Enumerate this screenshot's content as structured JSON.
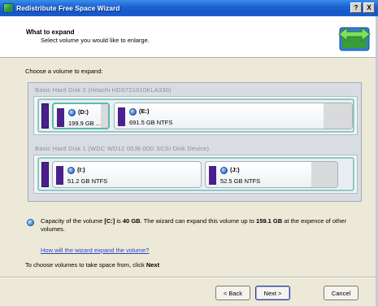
{
  "window": {
    "title": "Redistribute Free Space Wizard",
    "help_label": "?",
    "close_label": "X"
  },
  "header": {
    "title": "What to expand",
    "subtitle": "Select volume you would like to enlarge."
  },
  "body": {
    "choose_label": "Choose a volume to expand:"
  },
  "disks": [
    {
      "title": "Basic Hard Disk 0 (Hitachi HDS721010KLA330)",
      "volumes": [
        {
          "letter": "(D:)",
          "info": "199.9 GB ...",
          "selected": true,
          "fill_fraction": 0.13
        },
        {
          "letter": "(E:)",
          "info": "691.5 GB NTFS",
          "selected": false,
          "fill_fraction": 0.12
        }
      ]
    },
    {
      "title": "Basic Hard Disk 1 (WDC WD12 00J8-00D SCSI Disk Device)",
      "volumes": [
        {
          "letter": "(I:)",
          "info": "51.2 GB NTFS",
          "selected": false,
          "fill_fraction": 0.0
        },
        {
          "letter": "(J:)",
          "info": "52.5 GB NTFS",
          "selected": false,
          "fill_fraction": 0.2
        }
      ]
    }
  ],
  "info": {
    "part1": "Capacity of the volume ",
    "volume": "[C:]",
    "part2": " is ",
    "capacity": "40 GB",
    "part3": ". The wizard can expand this volume up to ",
    "max": "159.1 GB",
    "part4": " at the expence of other volumes."
  },
  "link_text": "How will the wizard expand the volume?",
  "footer": {
    "text": "To choose volumes to take space from, click ",
    "next_word": "Next"
  },
  "buttons": {
    "back": "< Back",
    "next": "Next >",
    "cancel": "Cancel"
  },
  "colors": {
    "titlebar": "#1e63d4",
    "selected_border": "#5fb7b0",
    "volume_stripe": "#4b1f8c",
    "link": "#2b44c8"
  }
}
